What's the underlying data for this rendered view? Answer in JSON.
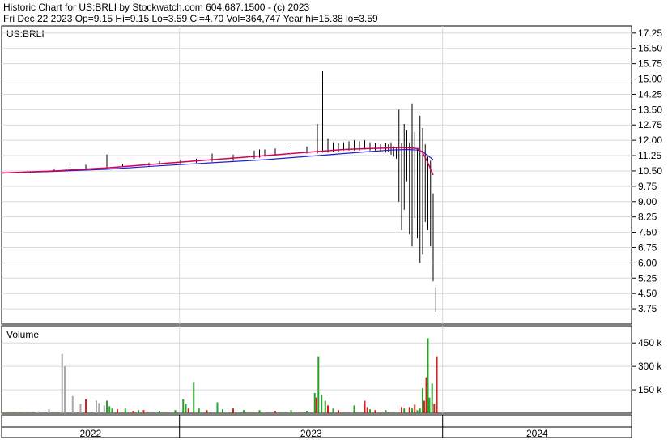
{
  "header": {
    "line1": "Historic Chart for US:BRLI by Stockwatch.com 604.687.1500 - (c) 2023",
    "line2": "Fri Dec 22 2023  Op=9.15  Hi=9.15  Lo=3.59  Cl=4.70  Vol=364,747  Year hi=15.38  lo=3.59"
  },
  "colors": {
    "price_bar": "#000000",
    "ma_short": "#d4005a",
    "ma_long": "#2020cc",
    "volume_up": "#2ca02c",
    "volume_down": "#d62020",
    "volume_neutral": "#a8a8a8",
    "grid": "#d8d8d8"
  },
  "chart_data": [
    {
      "type": "line",
      "title": "US:BRLI",
      "ylim": [
        3.0,
        17.6
      ],
      "yticks": [
        "17.25",
        "16.50",
        "15.75",
        "15.00",
        "14.25",
        "13.50",
        "12.75",
        "12.00",
        "11.25",
        "10.50",
        "9.75",
        "9.00",
        "8.25",
        "7.50",
        "6.75",
        "6.00",
        "5.25",
        "4.50",
        "3.75"
      ],
      "grid": true,
      "series": [
        {
          "style": "hl-bars",
          "x_frac": [
            0.0,
            0.05,
            0.1,
            0.13,
            0.16,
            0.2,
            0.23,
            0.28,
            0.3,
            0.34,
            0.37,
            0.4,
            0.44,
            0.47,
            0.48,
            0.49,
            0.5,
            0.52,
            0.55,
            0.58,
            0.6,
            0.61,
            0.62,
            0.63,
            0.64,
            0.65,
            0.66,
            0.67,
            0.68,
            0.69,
            0.7,
            0.71,
            0.72,
            0.73,
            0.735,
            0.74,
            0.745,
            0.75,
            0.755,
            0.76,
            0.765,
            0.77,
            0.775,
            0.78,
            0.785,
            0.79,
            0.795,
            0.8,
            0.805,
            0.81,
            0.815,
            0.82,
            0.825
          ],
          "high": [
            10.5,
            10.55,
            10.62,
            10.7,
            10.8,
            11.3,
            10.85,
            10.9,
            10.98,
            11.05,
            11.1,
            11.35,
            11.3,
            11.4,
            11.5,
            11.55,
            11.55,
            11.6,
            11.65,
            11.7,
            12.8,
            15.38,
            12.1,
            11.9,
            11.85,
            11.9,
            11.95,
            12.0,
            11.95,
            12.0,
            11.9,
            11.85,
            11.8,
            11.85,
            11.8,
            11.9,
            11.7,
            11.6,
            13.5,
            11.85,
            12.8,
            12.5,
            11.9,
            13.8,
            12.4,
            11.6,
            13.2,
            12.6,
            11.8,
            11.2,
            11.0,
            9.4,
            4.8
          ],
          "low": [
            10.4,
            10.45,
            10.5,
            10.55,
            10.6,
            10.65,
            10.7,
            10.75,
            10.8,
            10.85,
            10.9,
            10.95,
            11.0,
            11.05,
            11.1,
            11.15,
            11.2,
            11.25,
            11.3,
            11.35,
            11.35,
            11.4,
            11.4,
            11.45,
            11.45,
            11.5,
            11.5,
            11.5,
            11.5,
            11.55,
            11.5,
            11.5,
            11.45,
            11.4,
            11.45,
            11.3,
            11.2,
            11.1,
            9.0,
            7.6,
            8.6,
            10.0,
            7.4,
            6.8,
            8.2,
            7.2,
            6.0,
            6.4,
            8.0,
            7.6,
            6.8,
            5.1,
            3.59
          ]
        },
        {
          "name": "",
          "style": "ma-short",
          "x_frac": [
            0.0,
            0.1,
            0.2,
            0.3,
            0.4,
            0.5,
            0.6,
            0.65,
            0.7,
            0.73,
            0.76,
            0.79,
            0.8,
            0.81,
            0.82
          ],
          "values": [
            10.4,
            10.5,
            10.65,
            10.85,
            11.05,
            11.25,
            11.45,
            11.55,
            11.6,
            11.62,
            11.65,
            11.6,
            11.4,
            10.9,
            10.3
          ]
        },
        {
          "name": "",
          "style": "ma-long",
          "x_frac": [
            0.0,
            0.1,
            0.2,
            0.3,
            0.4,
            0.5,
            0.6,
            0.65,
            0.7,
            0.74,
            0.77,
            0.79,
            0.8,
            0.81,
            0.82
          ],
          "values": [
            10.4,
            10.48,
            10.58,
            10.75,
            10.9,
            11.05,
            11.25,
            11.35,
            11.45,
            11.52,
            11.55,
            11.52,
            11.45,
            11.25,
            11.05
          ]
        }
      ]
    },
    {
      "type": "bar",
      "title": "Volume",
      "ylim": [
        0,
        560000
      ],
      "yticks": [
        "450 k",
        "300 k",
        "150 k"
      ],
      "bars": [
        {
          "x_frac": 0.07,
          "v": 12000,
          "c": "neutral"
        },
        {
          "x_frac": 0.09,
          "v": 25000,
          "c": "neutral"
        },
        {
          "x_frac": 0.115,
          "v": 380000,
          "c": "neutral"
        },
        {
          "x_frac": 0.12,
          "v": 300000,
          "c": "neutral"
        },
        {
          "x_frac": 0.135,
          "v": 110000,
          "c": "neutral"
        },
        {
          "x_frac": 0.15,
          "v": 60000,
          "c": "neutral"
        },
        {
          "x_frac": 0.16,
          "v": 90000,
          "c": "down"
        },
        {
          "x_frac": 0.18,
          "v": 80000,
          "c": "neutral"
        },
        {
          "x_frac": 0.185,
          "v": 65000,
          "c": "neutral"
        },
        {
          "x_frac": 0.195,
          "v": 50000,
          "c": "neutral"
        },
        {
          "x_frac": 0.2,
          "v": 80000,
          "c": "up"
        },
        {
          "x_frac": 0.205,
          "v": 45000,
          "c": "up"
        },
        {
          "x_frac": 0.21,
          "v": 30000,
          "c": "up"
        },
        {
          "x_frac": 0.22,
          "v": 25000,
          "c": "down"
        },
        {
          "x_frac": 0.235,
          "v": 30000,
          "c": "up"
        },
        {
          "x_frac": 0.25,
          "v": 15000,
          "c": "down"
        },
        {
          "x_frac": 0.26,
          "v": 20000,
          "c": "up"
        },
        {
          "x_frac": 0.27,
          "v": 20000,
          "c": "down"
        },
        {
          "x_frac": 0.3,
          "v": 15000,
          "c": "up"
        },
        {
          "x_frac": 0.33,
          "v": 20000,
          "c": "up"
        },
        {
          "x_frac": 0.345,
          "v": 90000,
          "c": "up"
        },
        {
          "x_frac": 0.35,
          "v": 60000,
          "c": "up"
        },
        {
          "x_frac": 0.355,
          "v": 30000,
          "c": "down"
        },
        {
          "x_frac": 0.365,
          "v": 195000,
          "c": "up"
        },
        {
          "x_frac": 0.375,
          "v": 30000,
          "c": "up"
        },
        {
          "x_frac": 0.39,
          "v": 20000,
          "c": "down"
        },
        {
          "x_frac": 0.41,
          "v": 70000,
          "c": "up"
        },
        {
          "x_frac": 0.42,
          "v": 25000,
          "c": "up"
        },
        {
          "x_frac": 0.44,
          "v": 30000,
          "c": "down"
        },
        {
          "x_frac": 0.46,
          "v": 20000,
          "c": "up"
        },
        {
          "x_frac": 0.49,
          "v": 20000,
          "c": "up"
        },
        {
          "x_frac": 0.52,
          "v": 15000,
          "c": "down"
        },
        {
          "x_frac": 0.55,
          "v": 20000,
          "c": "up"
        },
        {
          "x_frac": 0.58,
          "v": 15000,
          "c": "up"
        },
        {
          "x_frac": 0.595,
          "v": 130000,
          "c": "up"
        },
        {
          "x_frac": 0.598,
          "v": 100000,
          "c": "down"
        },
        {
          "x_frac": 0.602,
          "v": 365000,
          "c": "up"
        },
        {
          "x_frac": 0.608,
          "v": 120000,
          "c": "up"
        },
        {
          "x_frac": 0.615,
          "v": 80000,
          "c": "up"
        },
        {
          "x_frac": 0.62,
          "v": 50000,
          "c": "down"
        },
        {
          "x_frac": 0.63,
          "v": 30000,
          "c": "up"
        },
        {
          "x_frac": 0.64,
          "v": 20000,
          "c": "down"
        },
        {
          "x_frac": 0.67,
          "v": 50000,
          "c": "up"
        },
        {
          "x_frac": 0.69,
          "v": 80000,
          "c": "down"
        },
        {
          "x_frac": 0.695,
          "v": 40000,
          "c": "down"
        },
        {
          "x_frac": 0.7,
          "v": 25000,
          "c": "up"
        },
        {
          "x_frac": 0.71,
          "v": 20000,
          "c": "down"
        },
        {
          "x_frac": 0.73,
          "v": 20000,
          "c": "up"
        },
        {
          "x_frac": 0.76,
          "v": 40000,
          "c": "down"
        },
        {
          "x_frac": 0.765,
          "v": 30000,
          "c": "up"
        },
        {
          "x_frac": 0.775,
          "v": 40000,
          "c": "down"
        },
        {
          "x_frac": 0.78,
          "v": 30000,
          "c": "up"
        },
        {
          "x_frac": 0.785,
          "v": 55000,
          "c": "down"
        },
        {
          "x_frac": 0.79,
          "v": 20000,
          "c": "up"
        },
        {
          "x_frac": 0.795,
          "v": 30000,
          "c": "up"
        },
        {
          "x_frac": 0.8,
          "v": 160000,
          "c": "up"
        },
        {
          "x_frac": 0.803,
          "v": 80000,
          "c": "down"
        },
        {
          "x_frac": 0.807,
          "v": 230000,
          "c": "down"
        },
        {
          "x_frac": 0.81,
          "v": 480000,
          "c": "up"
        },
        {
          "x_frac": 0.813,
          "v": 100000,
          "c": "up"
        },
        {
          "x_frac": 0.818,
          "v": 190000,
          "c": "up"
        },
        {
          "x_frac": 0.822,
          "v": 60000,
          "c": "down"
        },
        {
          "x_frac": 0.827,
          "v": 365000,
          "c": "down"
        }
      ]
    }
  ],
  "time_axis": {
    "labels": [
      "2022",
      "2023",
      "2024"
    ],
    "boundaries_frac": [
      0.0,
      0.338,
      0.838,
      1.0
    ]
  }
}
